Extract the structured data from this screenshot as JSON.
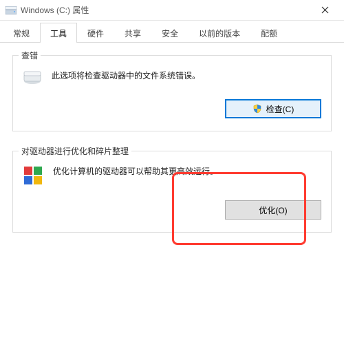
{
  "window": {
    "title": "Windows (C:) 属性"
  },
  "tabs": {
    "general": "常规",
    "tools": "工具",
    "hardware": "硬件",
    "sharing": "共享",
    "security": "安全",
    "previous": "以前的版本",
    "quota": "配额"
  },
  "check_group": {
    "title": "查错",
    "desc": "此选项将检查驱动器中的文件系统错误。",
    "button": "检查(C)"
  },
  "optimize_group": {
    "title": "对驱动器进行优化和碎片整理",
    "desc": "优化计算机的驱动器可以帮助其更高效运行。",
    "button": "优化(O)"
  }
}
